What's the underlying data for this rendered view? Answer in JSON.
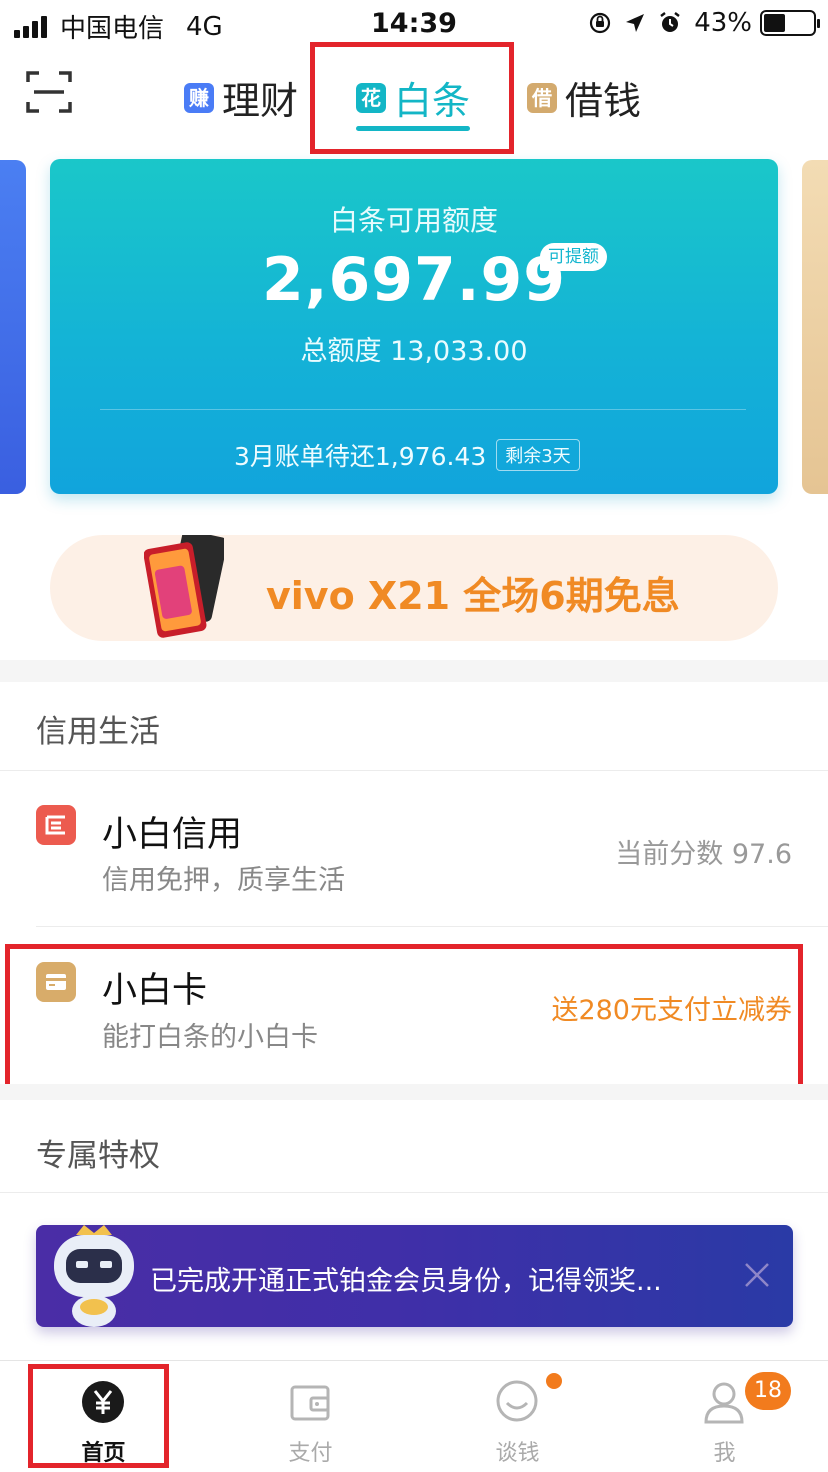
{
  "status_bar": {
    "carrier": "中国电信",
    "network": "4G",
    "time": "14:39",
    "battery": "43%",
    "battery_level": 0.43
  },
  "top_nav": {
    "tabs": [
      {
        "badge": "赚",
        "label": "理财"
      },
      {
        "badge": "花",
        "label": "白条",
        "active": true
      },
      {
        "badge": "借",
        "label": "借钱"
      }
    ]
  },
  "credit_card": {
    "label": "白条可用额度",
    "available": "2,697.99",
    "raise_button": "可提额",
    "total": "总额度 13,033.00",
    "bill": "3月账单待还1,976.43",
    "remaining_days": "剩余3天"
  },
  "promo_banner": {
    "text": "vivo X21 全场6期免息"
  },
  "credit_life": {
    "title": "信用生活",
    "items": [
      {
        "icon": "credit-score-icon",
        "title": "小白信用",
        "subtitle": "信用免押，质享生活",
        "right_text": "当前分数 97.6"
      },
      {
        "icon": "card-icon",
        "title": "小白卡",
        "subtitle": "能打白条的小白卡",
        "right_text": "送280元支付立减券"
      }
    ]
  },
  "privileges": {
    "title": "专属特权",
    "notice": "已完成开通正式铂金会员身份，记得领奖..."
  },
  "tab_bar": {
    "items": [
      {
        "label": "首页",
        "icon": "yen-icon",
        "active": true
      },
      {
        "label": "支付",
        "icon": "wallet-icon"
      },
      {
        "label": "谈钱",
        "icon": "chat-icon",
        "dot": true
      },
      {
        "label": "我",
        "icon": "person-icon",
        "badge": "18"
      }
    ]
  },
  "colors": {
    "accent": "#13b6c6",
    "highlight_frame": "#e3242b",
    "promo_orange": "#f08a24",
    "badge_orange": "#f27b1d"
  }
}
